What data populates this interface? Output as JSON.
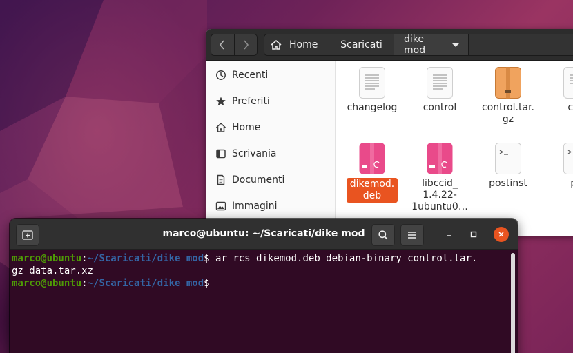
{
  "files_window": {
    "breadcrumb": [
      "Home",
      "Scaricati",
      "dike mod"
    ],
    "sidebar": [
      {
        "label": "Recenti",
        "icon": "clock-icon"
      },
      {
        "label": "Preferiti",
        "icon": "star-icon"
      },
      {
        "label": "Home",
        "icon": "home-icon"
      },
      {
        "label": "Scrivania",
        "icon": "desktop-icon"
      },
      {
        "label": "Documenti",
        "icon": "document-icon"
      },
      {
        "label": "Immagini",
        "icon": "image-icon"
      }
    ],
    "files": [
      {
        "name_lines": [
          "changelog"
        ],
        "type": "text-file-icon"
      },
      {
        "name_lines": [
          "control"
        ],
        "type": "text-file-icon"
      },
      {
        "name_lines": [
          "control.tar.",
          "gz"
        ],
        "type": "archive-icon"
      },
      {
        "name_lines": [
          "cop"
        ],
        "type": "text-file-icon"
      },
      {
        "name_lines": [
          "dikemod.",
          "deb"
        ],
        "type": "deb-package-icon",
        "selected": true
      },
      {
        "name_lines": [
          "libccid_",
          "1.4.22-",
          "1ubuntu0…"
        ],
        "type": "deb-package-icon"
      },
      {
        "name_lines": [
          "postinst"
        ],
        "type": "script-file-icon"
      },
      {
        "name_lines": [
          "po"
        ],
        "type": "script-file-icon"
      }
    ]
  },
  "terminal": {
    "title": "marco@ubuntu: ~/Scaricati/dike mod",
    "lines": [
      {
        "user": "marco@ubuntu",
        "sep": ":",
        "path": "~/Scaricati/dike mod",
        "prompt": "$",
        "command": " ar rcs dikemod.deb debian-binary control.tar."
      },
      {
        "text": "gz data.tar.xz"
      },
      {
        "user": "marco@ubuntu",
        "sep": ":",
        "path": "~/Scaricati/dike mod",
        "prompt": "$",
        "command": ""
      }
    ]
  },
  "colors": {
    "accent": "#e95420",
    "terminal_bg": "#300a24",
    "prompt_user": "#4e9a06",
    "prompt_path": "#3465a4"
  }
}
